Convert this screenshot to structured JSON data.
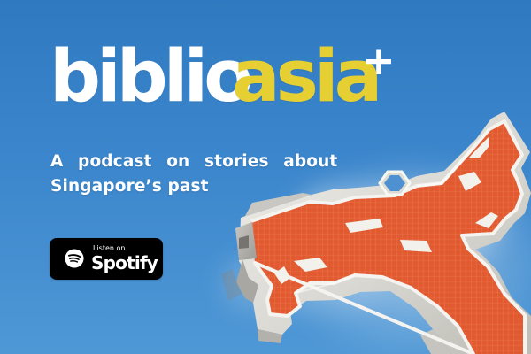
{
  "logo": {
    "biblio": "biblio",
    "asia": "asia",
    "plus": "+"
  },
  "tagline": {
    "line1": "A podcast on stories about",
    "line2": "Singapore’s past"
  },
  "spotify_badge": {
    "small_text": "Listen on",
    "brand_text": "Spotify",
    "icon": "spotify-icon"
  },
  "artwork": {
    "icon": "dragon-sculpture-icon"
  },
  "colors": {
    "sky": "#3b86cc",
    "logo_white": "#ffffff",
    "logo_yellow": "#e6cf32",
    "badge_black": "#000000",
    "sculpture_red": "#e35b31",
    "sculpture_gray": "#d8d6d0"
  }
}
